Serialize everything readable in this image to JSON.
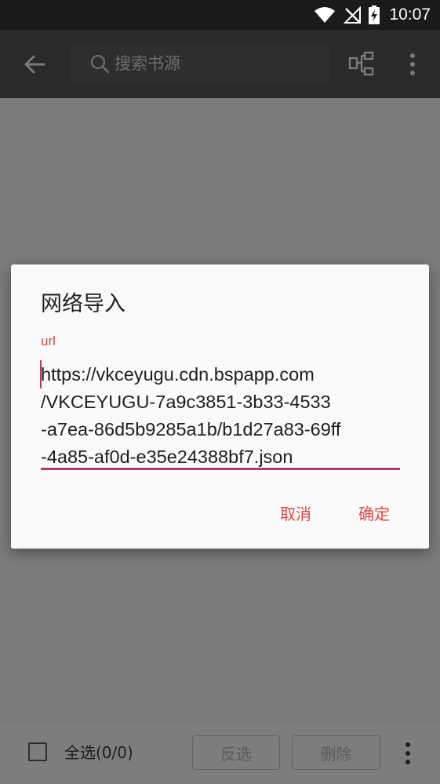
{
  "status_bar": {
    "time": "10:07",
    "icons": [
      "wifi-icon",
      "no-signal-icon",
      "battery-charging-icon"
    ]
  },
  "toolbar": {
    "back_icon": "arrow-left-icon",
    "search_placeholder": "搜索书源",
    "group_icon": "group-icon",
    "more_icon": "more-vert-icon"
  },
  "bottom_bar": {
    "select_all_label": "全选(0/0)",
    "invert_label": "反选",
    "delete_label": "删除",
    "more_icon": "more-vert-icon"
  },
  "dialog": {
    "title": "网络导入",
    "field_label": "url",
    "url_value": "https://vkceyugu.cdn.bspapp.com\n/VKCEYUGU-7a9c3851-3b33-4533\n-a7ea-86d5b9285a1b/b1d27a83-69ff\n-4a85-af0d-e35e24388bf7.json",
    "cancel_label": "取消",
    "ok_label": "确定"
  },
  "colors": {
    "accent": "#b23a6a",
    "button_text": "#e0463e",
    "label": "#c94a4a",
    "dim_overlay": "#7b7b7b"
  }
}
